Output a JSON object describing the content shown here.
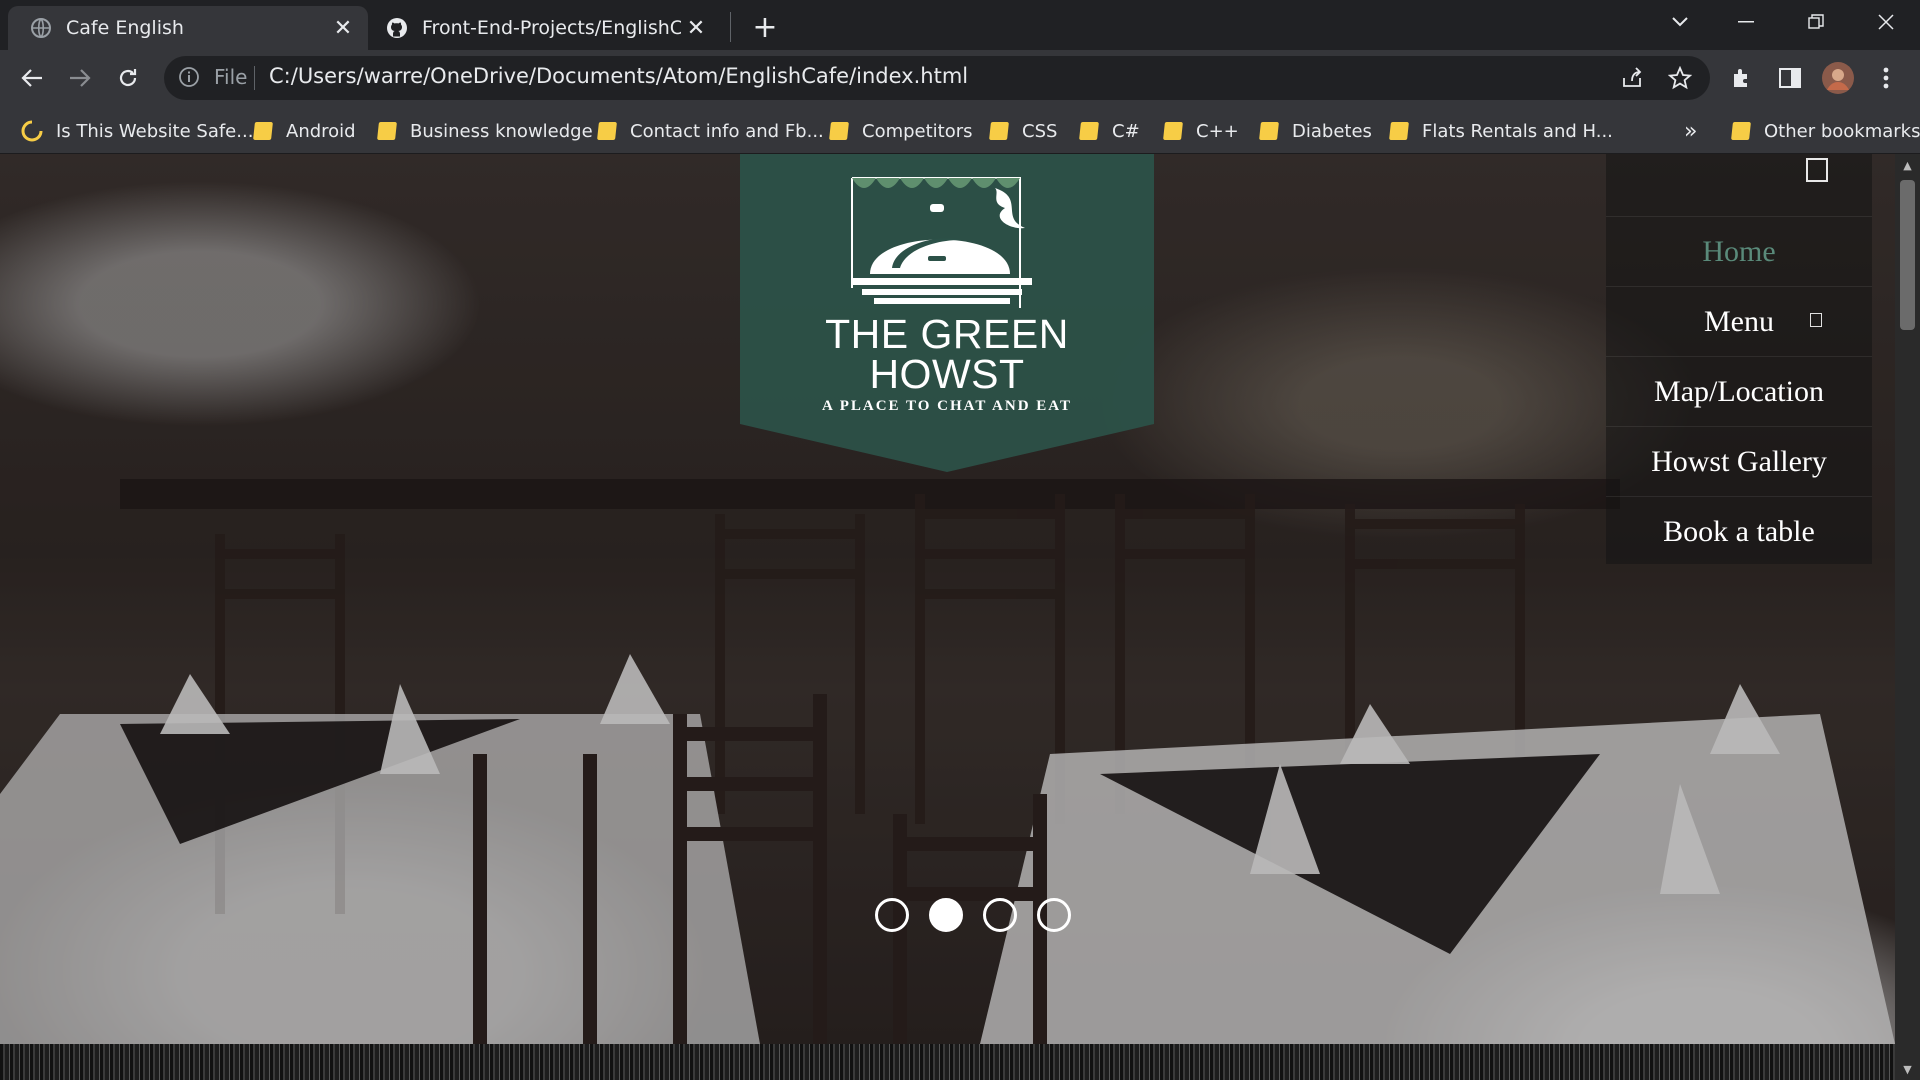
{
  "browser": {
    "tabs": [
      {
        "title": "Cafe English",
        "icon": "globe-icon",
        "active": true
      },
      {
        "title": "Front-End-Projects/EnglishCafeW",
        "icon": "github-icon",
        "active": false
      }
    ],
    "address": {
      "scheme_label": "File",
      "url": "C:/Users/warre/OneDrive/Documents/Atom/EnglishCafe/index.html"
    },
    "bookmarks": [
      {
        "label": "Is This Website Safe...",
        "icon": "loading-icon"
      },
      {
        "label": "Android",
        "icon": "folder-icon"
      },
      {
        "label": "Business knowledge",
        "icon": "folder-icon"
      },
      {
        "label": "Contact info and Fb...",
        "icon": "folder-icon"
      },
      {
        "label": "Competitors",
        "icon": "folder-icon"
      },
      {
        "label": "CSS",
        "icon": "folder-icon"
      },
      {
        "label": "C#",
        "icon": "folder-icon"
      },
      {
        "label": "C++",
        "icon": "folder-icon"
      },
      {
        "label": "Diabetes",
        "icon": "folder-icon"
      },
      {
        "label": "Flats Rentals and H...",
        "icon": "folder-icon"
      }
    ],
    "overflow_label": "»",
    "other_bookmarks": "Other bookmarks"
  },
  "site": {
    "brand": {
      "line1": "THE GREEN",
      "line2": "HOWST",
      "tagline": "A PLACE TO CHAT AND EAT"
    },
    "nav": [
      {
        "label": "Home",
        "active": true
      },
      {
        "label": "Menu",
        "active": false,
        "has_submenu": true
      },
      {
        "label": "Map/Location",
        "active": false
      },
      {
        "label": "Howst Gallery",
        "active": false
      },
      {
        "label": "Book a table",
        "active": false
      }
    ],
    "carousel": {
      "slides": 4,
      "active_index": 1
    }
  },
  "colors": {
    "banner_green": "#2c5148",
    "nav_active": "#5a8a7a",
    "bookmark_folder": "#f7cd46",
    "chrome_dark": "#202124",
    "chrome_toolbar": "#35363a"
  }
}
